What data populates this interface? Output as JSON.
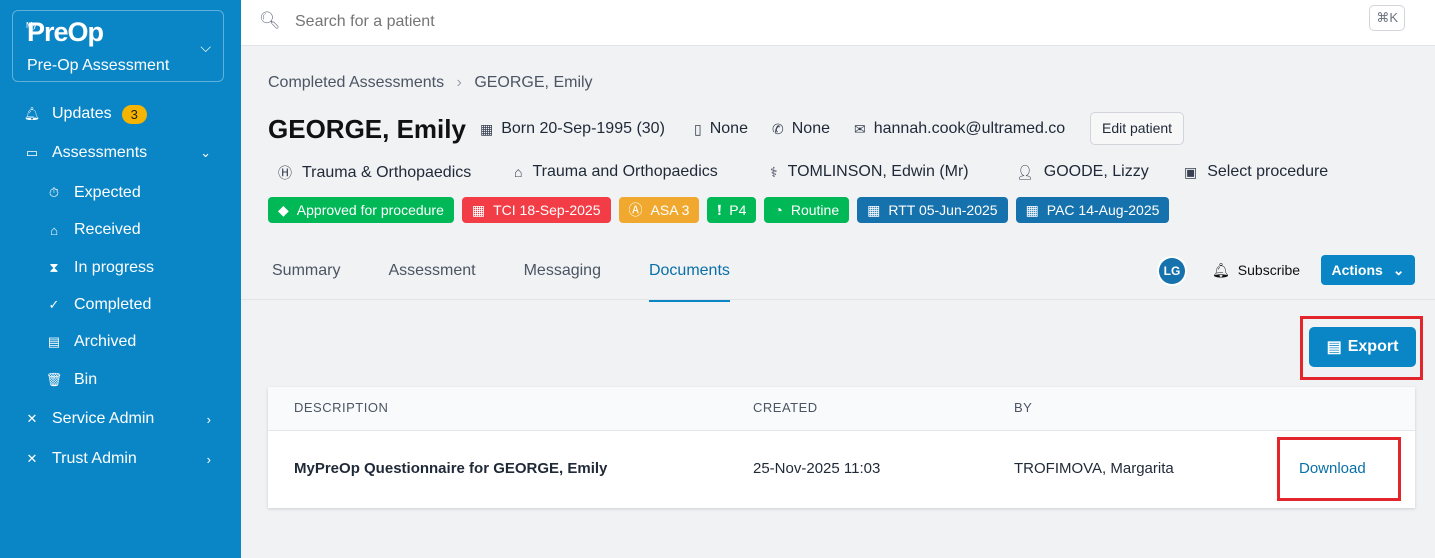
{
  "sidebar": {
    "logo_small": "My",
    "logo": "PreOp",
    "subtitle": "Pre-Op Assessment",
    "items": [
      {
        "label": "Updates",
        "icon": "bell-icon",
        "badge": "3"
      },
      {
        "label": "Assessments",
        "icon": "clipboard-icon"
      },
      {
        "label": "Expected",
        "icon": "stopwatch-icon"
      },
      {
        "label": "Received",
        "icon": "inbox-icon"
      },
      {
        "label": "In progress",
        "icon": "hourglass-icon"
      },
      {
        "label": "Completed",
        "icon": "clipboard-check-icon"
      },
      {
        "label": "Archived",
        "icon": "archive-icon"
      },
      {
        "label": "Bin",
        "icon": "trash-icon"
      },
      {
        "label": "Service Admin",
        "icon": "tools-icon"
      },
      {
        "label": "Trust Admin",
        "icon": "tools-icon"
      }
    ]
  },
  "search": {
    "placeholder": "Search for a patient",
    "shortcut": "⌘K"
  },
  "breadcrumb": {
    "parent": "Completed Assessments",
    "current": "GEORGE, Emily"
  },
  "patient": {
    "name": "GEORGE, Emily",
    "born": "Born 20-Sep-1995 (30)",
    "mobile": "None",
    "phone": "None",
    "email": "hannah.cook@ultramed.co",
    "edit": "Edit patient",
    "hospital": "Trauma & Orthopaedics",
    "department": "Trauma and Orthopaedics",
    "consultant": "TOMLINSON, Edwin (Mr)",
    "assessor": "GOODE, Lizzy",
    "procedure": "Select procedure"
  },
  "tags": [
    {
      "label": "Approved for procedure",
      "color": "#00b856"
    },
    {
      "label": "TCI 18-Sep-2025",
      "color": "#f23d46"
    },
    {
      "label": "ASA 3",
      "color": "#f0a92e"
    },
    {
      "label": "P4",
      "color": "#00b856"
    },
    {
      "label": "Routine",
      "color": "#00b856"
    },
    {
      "label": "RTT 05-Jun-2025",
      "color": "#1572ad"
    },
    {
      "label": "PAC 14-Aug-2025",
      "color": "#1572ad"
    }
  ],
  "tabs": [
    "Summary",
    "Assessment",
    "Messaging",
    "Documents"
  ],
  "header_actions": {
    "avatar": "LG",
    "subscribe": "Subscribe",
    "actions": "Actions"
  },
  "export": "Export",
  "table": {
    "headers": [
      "DESCRIPTION",
      "CREATED",
      "BY"
    ],
    "rows": [
      {
        "description": "MyPreOp Questionnaire for GEORGE, Emily",
        "created": "25-Nov-2025 11:03",
        "by": "TROFIMOVA, Margarita",
        "action": "Download"
      }
    ]
  }
}
